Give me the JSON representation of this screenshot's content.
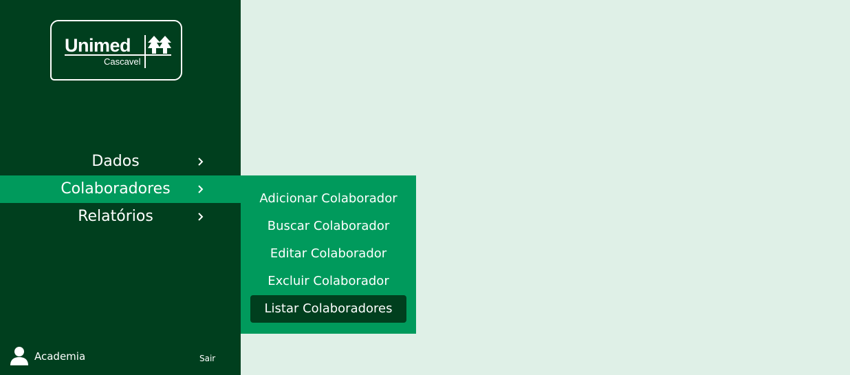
{
  "logo": {
    "name": "Unimed",
    "subtitle": "Cascavel"
  },
  "nav": {
    "items": [
      {
        "label": "Dados",
        "active": false
      },
      {
        "label": "Colaboradores",
        "active": true
      },
      {
        "label": "Relatórios",
        "active": false
      }
    ]
  },
  "submenu": {
    "items": [
      {
        "label": "Adicionar Colaborador",
        "selected": false
      },
      {
        "label": "Buscar Colaborador",
        "selected": false
      },
      {
        "label": "Editar Colaborador",
        "selected": false
      },
      {
        "label": "Excluir Colaborador",
        "selected": false
      },
      {
        "label": "Listar Colaboradores",
        "selected": true
      }
    ]
  },
  "user": {
    "name": "Academia",
    "icon": "user-icon",
    "logout_label": "Sair"
  },
  "colors": {
    "sidebar": "#003f1e",
    "accent": "#009a5c",
    "content_bg": "#dff0e7",
    "text": "#ffffff"
  }
}
